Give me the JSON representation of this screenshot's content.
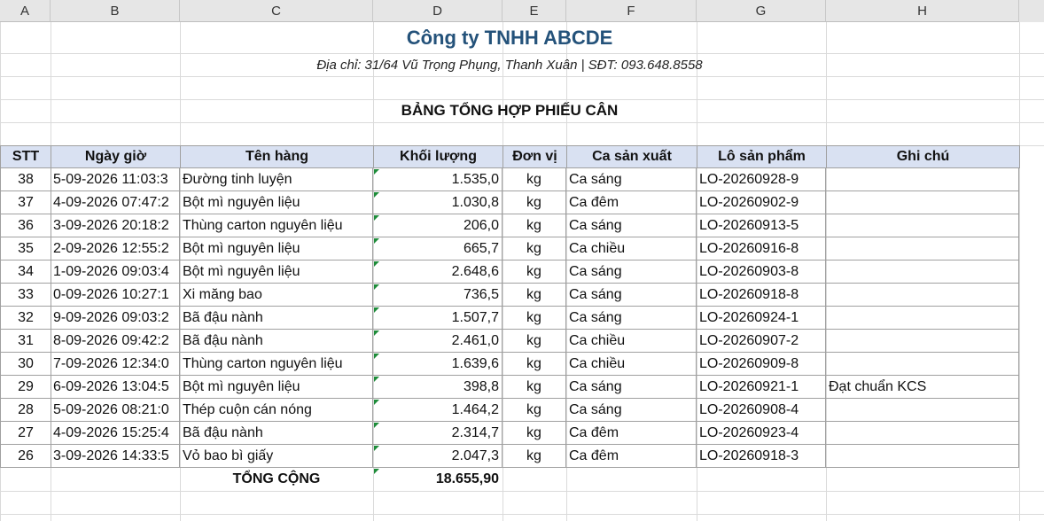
{
  "column_headers": [
    "A",
    "B",
    "C",
    "D",
    "E",
    "F",
    "G",
    "H"
  ],
  "company_name": "Công ty TNHH ABCDE",
  "address_line": "Địa chỉ: 31/64 Vũ Trọng Phụng, Thanh Xuân | SĐT: 093.648.8558",
  "report_title": "BẢNG TỔNG HỢP PHIẾU CÂN",
  "table": {
    "headers": [
      "STT",
      "Ngày giờ",
      "Tên hàng",
      "Khối lượng",
      "Đơn vị",
      "Ca sản xuất",
      "Lô sản phẩm",
      "Ghi chú"
    ],
    "rows": [
      [
        "38",
        "5-09-2026 11:03:3",
        "Đường tinh luyện",
        "1.535,0",
        "kg",
        "Ca sáng",
        "LO-20260928-9",
        ""
      ],
      [
        "37",
        "4-09-2026 07:47:2",
        "Bột mì nguyên liệu",
        "1.030,8",
        "kg",
        "Ca đêm",
        "LO-20260902-9",
        ""
      ],
      [
        "36",
        "3-09-2026 20:18:2",
        "Thùng carton nguyên liệu",
        "206,0",
        "kg",
        "Ca sáng",
        "LO-20260913-5",
        ""
      ],
      [
        "35",
        "2-09-2026 12:55:2",
        "Bột mì nguyên liệu",
        "665,7",
        "kg",
        "Ca chiều",
        "LO-20260916-8",
        ""
      ],
      [
        "34",
        "1-09-2026 09:03:4",
        "Bột mì nguyên liệu",
        "2.648,6",
        "kg",
        "Ca sáng",
        "LO-20260903-8",
        ""
      ],
      [
        "33",
        "0-09-2026 10:27:1",
        "Xi măng bao",
        "736,5",
        "kg",
        "Ca sáng",
        "LO-20260918-8",
        ""
      ],
      [
        "32",
        "9-09-2026 09:03:2",
        "Bã đậu nành",
        "1.507,7",
        "kg",
        "Ca sáng",
        "LO-20260924-1",
        ""
      ],
      [
        "31",
        "8-09-2026 09:42:2",
        "Bã đậu nành",
        "2.461,0",
        "kg",
        "Ca chiều",
        "LO-20260907-2",
        ""
      ],
      [
        "30",
        "7-09-2026 12:34:0",
        "Thùng carton nguyên liệu",
        "1.639,6",
        "kg",
        "Ca chiều",
        "LO-20260909-8",
        ""
      ],
      [
        "29",
        "6-09-2026 13:04:5",
        "Bột mì nguyên liệu",
        "398,8",
        "kg",
        "Ca sáng",
        "LO-20260921-1",
        "Đạt chuẩn KCS"
      ],
      [
        "28",
        "5-09-2026 08:21:0",
        "Thép cuộn cán nóng",
        "1.464,2",
        "kg",
        "Ca sáng",
        "LO-20260908-4",
        ""
      ],
      [
        "27",
        "4-09-2026 15:25:4",
        "Bã đậu nành",
        "2.314,7",
        "kg",
        "Ca đêm",
        "LO-20260923-4",
        ""
      ],
      [
        "26",
        "3-09-2026 14:33:5",
        "Vỏ bao bì giấy",
        "2.047,3",
        "kg",
        "Ca đêm",
        "LO-20260918-3",
        ""
      ]
    ],
    "total_label": "TỔNG CỘNG",
    "total_value": "18.655,90"
  },
  "colors": {
    "title": "#24527a",
    "header_fill": "#d9e1f2",
    "indicator": "#1e8c3a"
  }
}
